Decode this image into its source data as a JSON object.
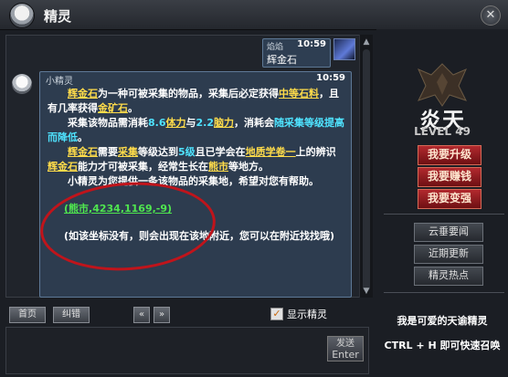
{
  "window": {
    "title": "精灵",
    "close_icon": "✕"
  },
  "player_message": {
    "name": "焰焰",
    "time": "10:59",
    "text": "辉金石"
  },
  "npc_message": {
    "name": "小精灵",
    "time": "10:59",
    "p1": [
      "辉金石",
      "为一种可被采集的物品，采集后必定获得",
      "中等石料",
      "，且有几率获得",
      "金矿石",
      "。"
    ],
    "p2": [
      "采集该物品需消耗",
      "8.6",
      "体力",
      "与",
      "2.2",
      "脑力",
      "，消耗会",
      "随采集等级提高而降低",
      "。"
    ],
    "p3": [
      "辉金石",
      "需要",
      "采集",
      "等级达到",
      "5级",
      "且已学会在",
      "地质学卷一",
      "上的辨识",
      "辉金石",
      "能力才可被采集，经常生长在",
      "熊市",
      "等地方。"
    ],
    "p4": "小精灵为您提供一条该物品的采集地，希望对您有帮助。",
    "coordinate_link": "(熊市,4234,1169,-9)",
    "note": "(如该坐标没有，则会出现在该地附近，您可以在附近找找哦)"
  },
  "bottom_bar": {
    "home_button": "首页",
    "correct_button": "纠错",
    "prev_icon": "«",
    "next_icon": "»",
    "show_sprite_label": "显示精灵",
    "show_sprite_checked": true
  },
  "send_button": {
    "label": "发送",
    "sub": "Enter"
  },
  "right_panel": {
    "level_name": "炎天",
    "level_text": "LEVEL 49",
    "red_buttons": [
      "我要升级",
      "我要赚钱",
      "我要变强"
    ],
    "grey_buttons": [
      "云垂要闻",
      "近期更新",
      "精灵热点"
    ],
    "slogan": "我是可爱的天谕精灵",
    "hint": "CTRL + H 即可快速召唤"
  },
  "colors": {
    "keyword": "#ffdc4a",
    "highlight": "#4fe3ff",
    "link": "#4fe64f",
    "annotation": "#c0141b"
  }
}
